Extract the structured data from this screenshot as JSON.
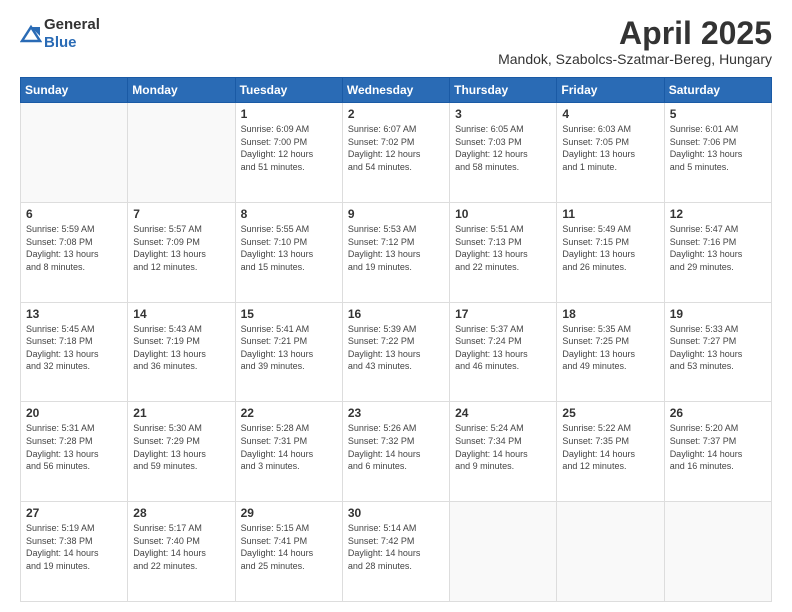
{
  "header": {
    "logo_general": "General",
    "logo_blue": "Blue",
    "month": "April 2025",
    "location": "Mandok, Szabolcs-Szatmar-Bereg, Hungary"
  },
  "days_of_week": [
    "Sunday",
    "Monday",
    "Tuesday",
    "Wednesday",
    "Thursday",
    "Friday",
    "Saturday"
  ],
  "weeks": [
    [
      {
        "day": "",
        "info": ""
      },
      {
        "day": "",
        "info": ""
      },
      {
        "day": "1",
        "info": "Sunrise: 6:09 AM\nSunset: 7:00 PM\nDaylight: 12 hours\nand 51 minutes."
      },
      {
        "day": "2",
        "info": "Sunrise: 6:07 AM\nSunset: 7:02 PM\nDaylight: 12 hours\nand 54 minutes."
      },
      {
        "day": "3",
        "info": "Sunrise: 6:05 AM\nSunset: 7:03 PM\nDaylight: 12 hours\nand 58 minutes."
      },
      {
        "day": "4",
        "info": "Sunrise: 6:03 AM\nSunset: 7:05 PM\nDaylight: 13 hours\nand 1 minute."
      },
      {
        "day": "5",
        "info": "Sunrise: 6:01 AM\nSunset: 7:06 PM\nDaylight: 13 hours\nand 5 minutes."
      }
    ],
    [
      {
        "day": "6",
        "info": "Sunrise: 5:59 AM\nSunset: 7:08 PM\nDaylight: 13 hours\nand 8 minutes."
      },
      {
        "day": "7",
        "info": "Sunrise: 5:57 AM\nSunset: 7:09 PM\nDaylight: 13 hours\nand 12 minutes."
      },
      {
        "day": "8",
        "info": "Sunrise: 5:55 AM\nSunset: 7:10 PM\nDaylight: 13 hours\nand 15 minutes."
      },
      {
        "day": "9",
        "info": "Sunrise: 5:53 AM\nSunset: 7:12 PM\nDaylight: 13 hours\nand 19 minutes."
      },
      {
        "day": "10",
        "info": "Sunrise: 5:51 AM\nSunset: 7:13 PM\nDaylight: 13 hours\nand 22 minutes."
      },
      {
        "day": "11",
        "info": "Sunrise: 5:49 AM\nSunset: 7:15 PM\nDaylight: 13 hours\nand 26 minutes."
      },
      {
        "day": "12",
        "info": "Sunrise: 5:47 AM\nSunset: 7:16 PM\nDaylight: 13 hours\nand 29 minutes."
      }
    ],
    [
      {
        "day": "13",
        "info": "Sunrise: 5:45 AM\nSunset: 7:18 PM\nDaylight: 13 hours\nand 32 minutes."
      },
      {
        "day": "14",
        "info": "Sunrise: 5:43 AM\nSunset: 7:19 PM\nDaylight: 13 hours\nand 36 minutes."
      },
      {
        "day": "15",
        "info": "Sunrise: 5:41 AM\nSunset: 7:21 PM\nDaylight: 13 hours\nand 39 minutes."
      },
      {
        "day": "16",
        "info": "Sunrise: 5:39 AM\nSunset: 7:22 PM\nDaylight: 13 hours\nand 43 minutes."
      },
      {
        "day": "17",
        "info": "Sunrise: 5:37 AM\nSunset: 7:24 PM\nDaylight: 13 hours\nand 46 minutes."
      },
      {
        "day": "18",
        "info": "Sunrise: 5:35 AM\nSunset: 7:25 PM\nDaylight: 13 hours\nand 49 minutes."
      },
      {
        "day": "19",
        "info": "Sunrise: 5:33 AM\nSunset: 7:27 PM\nDaylight: 13 hours\nand 53 minutes."
      }
    ],
    [
      {
        "day": "20",
        "info": "Sunrise: 5:31 AM\nSunset: 7:28 PM\nDaylight: 13 hours\nand 56 minutes."
      },
      {
        "day": "21",
        "info": "Sunrise: 5:30 AM\nSunset: 7:29 PM\nDaylight: 13 hours\nand 59 minutes."
      },
      {
        "day": "22",
        "info": "Sunrise: 5:28 AM\nSunset: 7:31 PM\nDaylight: 14 hours\nand 3 minutes."
      },
      {
        "day": "23",
        "info": "Sunrise: 5:26 AM\nSunset: 7:32 PM\nDaylight: 14 hours\nand 6 minutes."
      },
      {
        "day": "24",
        "info": "Sunrise: 5:24 AM\nSunset: 7:34 PM\nDaylight: 14 hours\nand 9 minutes."
      },
      {
        "day": "25",
        "info": "Sunrise: 5:22 AM\nSunset: 7:35 PM\nDaylight: 14 hours\nand 12 minutes."
      },
      {
        "day": "26",
        "info": "Sunrise: 5:20 AM\nSunset: 7:37 PM\nDaylight: 14 hours\nand 16 minutes."
      }
    ],
    [
      {
        "day": "27",
        "info": "Sunrise: 5:19 AM\nSunset: 7:38 PM\nDaylight: 14 hours\nand 19 minutes."
      },
      {
        "day": "28",
        "info": "Sunrise: 5:17 AM\nSunset: 7:40 PM\nDaylight: 14 hours\nand 22 minutes."
      },
      {
        "day": "29",
        "info": "Sunrise: 5:15 AM\nSunset: 7:41 PM\nDaylight: 14 hours\nand 25 minutes."
      },
      {
        "day": "30",
        "info": "Sunrise: 5:14 AM\nSunset: 7:42 PM\nDaylight: 14 hours\nand 28 minutes."
      },
      {
        "day": "",
        "info": ""
      },
      {
        "day": "",
        "info": ""
      },
      {
        "day": "",
        "info": ""
      }
    ]
  ]
}
